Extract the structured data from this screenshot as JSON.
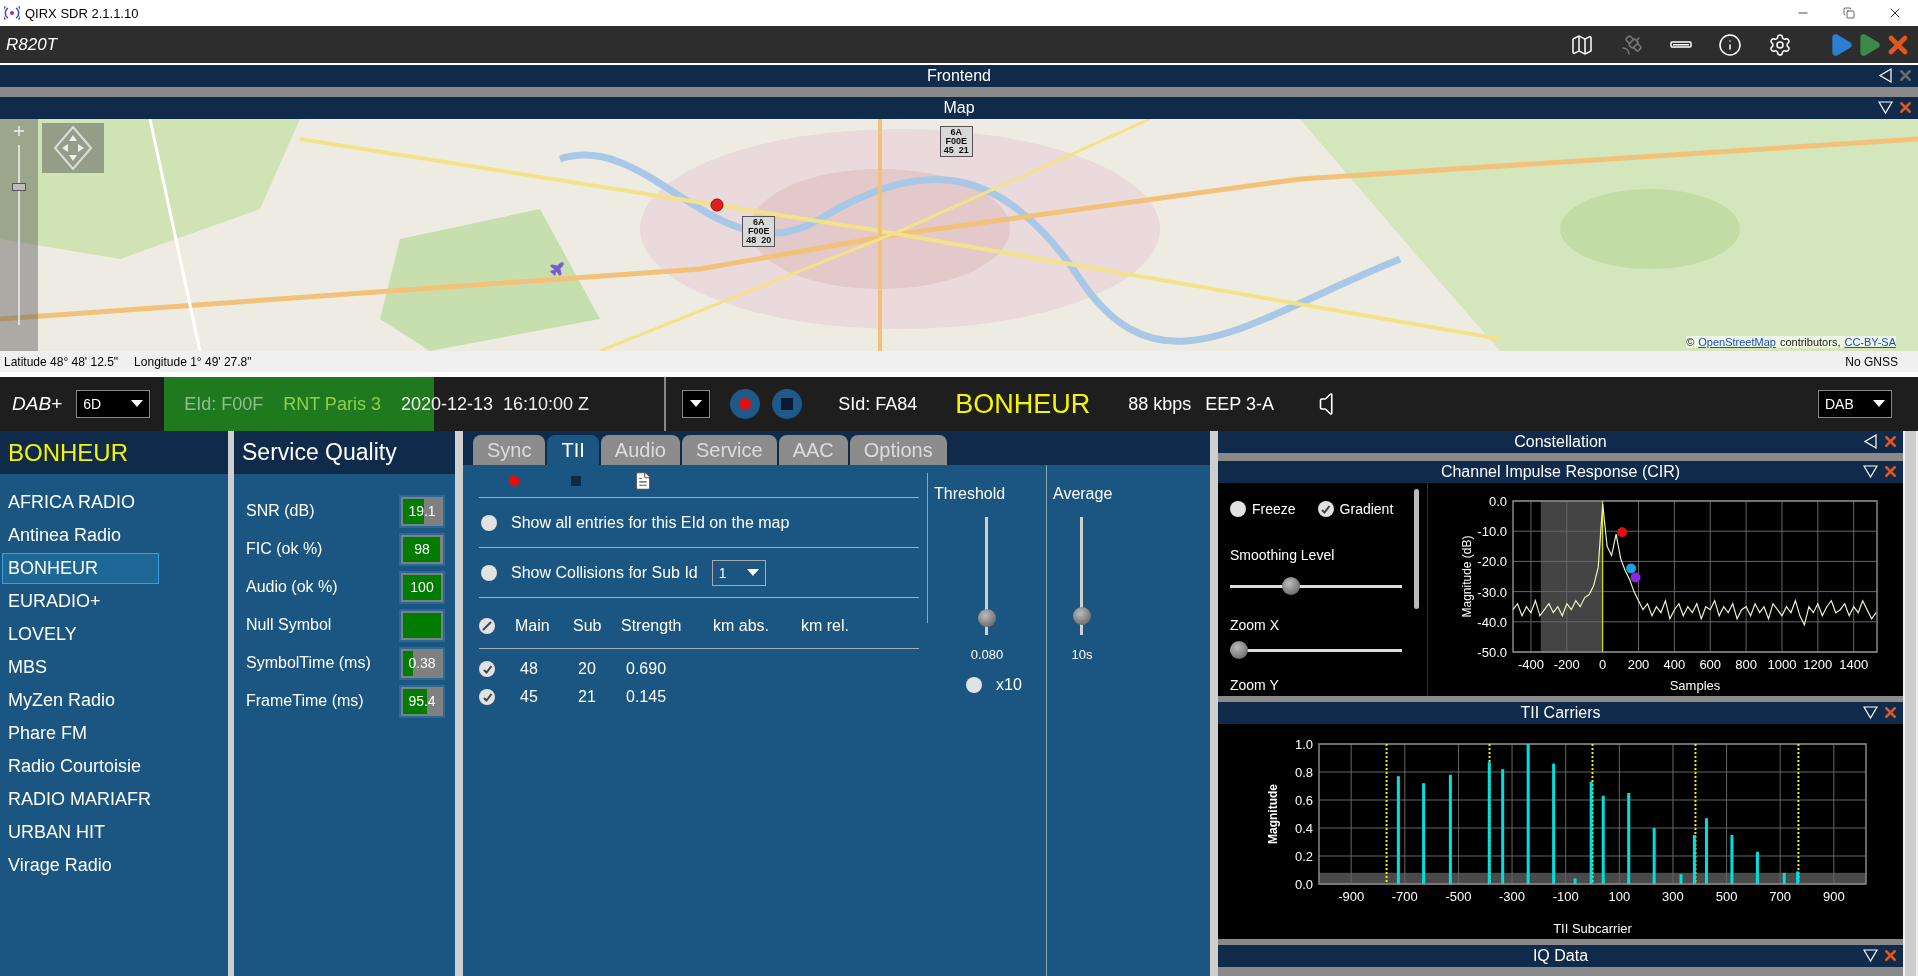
{
  "app": {
    "title": "QIRX SDR 2.1.1.10"
  },
  "toolbar": {
    "device": "R820T"
  },
  "top_panels": [
    {
      "title": "Frontend",
      "collapsed": true,
      "close_enabled": false
    },
    {
      "title": "Map",
      "collapsed": false,
      "close_enabled": true
    }
  ],
  "map": {
    "zoom": {
      "level": 0.78
    },
    "pins": [
      {
        "lines": [
          "6A",
          "F00E",
          "45  21"
        ]
      },
      {
        "lines": [
          "6A",
          "F00E",
          "48  20"
        ]
      }
    ],
    "attribution": {
      "prefix": "©",
      "link": "OpenStreetMap",
      "middle": "contributors,",
      "license": "CC-BY-SA"
    }
  },
  "map_status": {
    "latitude": "Latitude  48° 48' 12.5\"",
    "longitude": "Longitude  1° 49' 27.8\"",
    "gnss": "No GNSS"
  },
  "dab_bar": {
    "mode": "DAB+",
    "channel": "6D",
    "eid": "EId: F00F",
    "ensemble": "RNT Paris 3",
    "datetime": "2020-12-13  16:10:00 Z",
    "level": 0.54,
    "sid": "SId: FA84",
    "service": "BONHEUR",
    "bitrate": "88 kbps",
    "protection": "EEP 3-A",
    "band": "DAB"
  },
  "station_list": {
    "current": "BONHEUR",
    "items": [
      {
        "label": "AFRICA RADIO",
        "selected": false
      },
      {
        "label": "Antinea Radio",
        "selected": false
      },
      {
        "label": "BONHEUR",
        "selected": true
      },
      {
        "label": "EURADIO+",
        "selected": false
      },
      {
        "label": "LOVELY",
        "selected": false
      },
      {
        "label": "MBS",
        "selected": false
      },
      {
        "label": "MyZen Radio",
        "selected": false
      },
      {
        "label": "Phare FM",
        "selected": false
      },
      {
        "label": "Radio Courtoisie",
        "selected": false
      },
      {
        "label": "RADIO MARIAFR",
        "selected": false
      },
      {
        "label": "URBAN HIT",
        "selected": false
      },
      {
        "label": "Virage Radio",
        "selected": false
      }
    ]
  },
  "service_quality": {
    "title": "Service Quality",
    "metrics": [
      {
        "label": "SNR (dB)",
        "value": "19.1",
        "level": 0.56
      },
      {
        "label": "FIC (ok %)",
        "value": "98",
        "level": 0.98
      },
      {
        "label": "Audio (ok %)",
        "value": "100",
        "level": 1
      },
      {
        "label": "Null Symbol",
        "level": 1
      },
      {
        "label": "SymbolTime (ms)",
        "value": "0.38",
        "level": 0.25
      },
      {
        "label": "FrameTime (ms)",
        "value": "95.4",
        "level": 0.64
      }
    ]
  },
  "tabs": [
    {
      "label": "Sync",
      "selected": false
    },
    {
      "label": "TII",
      "selected": true
    },
    {
      "label": "Audio",
      "selected": false
    },
    {
      "label": "Service",
      "selected": false
    },
    {
      "label": "AAC",
      "selected": false
    },
    {
      "label": "Options",
      "selected": false
    }
  ],
  "tii": {
    "show_all": {
      "label": "Show all entries for this EId on the map",
      "checked": false
    },
    "collisions": {
      "label": "Show Collisions for Sub Id",
      "checked": false,
      "sub_id": "1"
    },
    "columns": [
      "Main",
      "Sub",
      "Strength",
      "km abs.",
      "km rel."
    ],
    "rows": [
      {
        "checked": true,
        "cells": [
          "48",
          "20",
          "0.690"
        ]
      },
      {
        "checked": true,
        "cells": [
          "45",
          "21",
          "0.145"
        ]
      }
    ],
    "threshold": {
      "label": "Threshold",
      "level": 0.08,
      "reading": "0.080",
      "x10": {
        "label": "x10",
        "checked": false
      }
    },
    "average": {
      "label": "Average",
      "level": 0.1,
      "reading": "10s"
    }
  },
  "constellation": {
    "title": "Constellation",
    "collapsed": true
  },
  "cir": {
    "title": "Channel Impulse Response (CIR)",
    "collapsed": false,
    "freeze": {
      "label": "Freeze",
      "checked": false
    },
    "gradient": {
      "label": "Gradient",
      "checked": true
    },
    "smoothing": {
      "label": "Smoothing Level",
      "level": 0.34
    },
    "zoom_x": {
      "label": "Zoom X",
      "level": 0
    },
    "zoom_y": {
      "label": "Zoom Y"
    },
    "peak_markers": [
      {
        "color": "#e01010"
      },
      {
        "color": "#20a0e0"
      },
      {
        "color": "#8a2be2"
      }
    ],
    "chart_data": {
      "type": "line",
      "xlabel": "Samples",
      "ylabel": "Magnitude (dB)",
      "grid": true,
      "x": [
        -500,
        -475,
        -450,
        -425,
        -400,
        -375,
        -350,
        -325,
        -300,
        -275,
        -250,
        -225,
        -200,
        -175,
        -150,
        -125,
        -100,
        -75,
        -50,
        -25,
        0,
        25,
        50,
        75,
        100,
        125,
        150,
        175,
        200,
        225,
        250,
        275,
        300,
        325,
        350,
        375,
        400,
        425,
        450,
        475,
        500,
        525,
        550,
        575,
        600,
        625,
        650,
        675,
        700,
        725,
        750,
        775,
        800,
        825,
        850,
        875,
        900,
        925,
        950,
        975,
        1000,
        1025,
        1050,
        1075,
        1100,
        1125,
        1150,
        1175,
        1200,
        1225,
        1250,
        1275,
        1300,
        1325,
        1350,
        1375,
        1400,
        1425,
        1450,
        1475,
        1500,
        1525
      ],
      "series": [
        {
          "color": "#e6f5c0",
          "values": [
            -36,
            -34,
            -38,
            -35,
            -37,
            -33,
            -38,
            -36,
            -34,
            -37,
            -35,
            -38,
            -34,
            -36,
            -33,
            -35,
            -32,
            -31,
            -28,
            -22,
            -1,
            -15,
            -18,
            -11,
            -19,
            -23,
            -26,
            -30,
            -33,
            -36,
            -34,
            -38,
            -35,
            -37,
            -33,
            -39,
            -36,
            -34,
            -38,
            -35,
            -37,
            -34,
            -39,
            -35,
            -36,
            -33,
            -38,
            -35,
            -37,
            -34,
            -39,
            -36,
            -35,
            -38,
            -34,
            -37,
            -35,
            -39,
            -34,
            -36,
            -38,
            -35,
            -37,
            -33,
            -38,
            -41,
            -35,
            -37,
            -34,
            -38,
            -35,
            -33,
            -37,
            -36,
            -34,
            -38,
            -35,
            -37,
            -33,
            -36,
            -39,
            -37
          ]
        }
      ],
      "xlim": [
        -500,
        1530
      ],
      "ylim": [
        -50,
        0
      ],
      "xticks": [
        -400,
        -200,
        0,
        200,
        400,
        600,
        800,
        1000,
        1200,
        1400
      ],
      "yticks": [
        {
          "value": 0,
          "label": "0.0"
        },
        {
          "value": -10,
          "label": "-10.0"
        },
        {
          "value": -20,
          "label": "-20.0"
        },
        {
          "value": -30,
          "label": "-30.0"
        },
        {
          "value": -40,
          "label": "-40.0"
        },
        {
          "value": -50,
          "label": "-50.0"
        }
      ],
      "bands": [
        {
          "axis": "x",
          "from": -345,
          "to": 0
        }
      ],
      "ref_lines": [
        {
          "axis": "x",
          "value": 0
        }
      ]
    }
  },
  "tii_carriers": {
    "title": "TII Carriers",
    "collapsed": false,
    "chart_data": {
      "type": "bar",
      "xlabel": "TII Subcarrier",
      "ylabel": "Magnitude",
      "grid": true,
      "x": [
        -724,
        -630,
        -530,
        -385,
        -335,
        -240,
        -145,
        -65,
        -5,
        40,
        135,
        230,
        330,
        380,
        425,
        520,
        615,
        715,
        765
      ],
      "series": [
        {
          "color": "#00e0e0",
          "values": [
            0.77,
            0.72,
            0.78,
            0.87,
            0.82,
            1.0,
            0.86,
            0.04,
            0.73,
            0.63,
            0.65,
            0.4,
            0.07,
            0.35,
            0.47,
            0.35,
            0.23,
            0.08,
            0.09
          ]
        }
      ],
      "xlim": [
        -1020,
        1020
      ],
      "ylim": [
        0,
        1
      ],
      "xticks": [
        -900,
        -700,
        -500,
        -300,
        -100,
        100,
        300,
        500,
        700,
        900
      ],
      "yticks": [
        {
          "value": 0,
          "label": "0.0"
        },
        {
          "value": 0.2,
          "label": "0.2"
        },
        {
          "value": 0.4,
          "label": "0.4"
        },
        {
          "value": 0.6,
          "label": "0.6"
        },
        {
          "value": 0.8,
          "label": "0.8"
        },
        {
          "value": 1,
          "label": "1.0"
        }
      ],
      "bands": [
        {
          "axis": "y",
          "from": 0,
          "to": 0.08
        }
      ],
      "ref_lines": [
        {
          "axis": "x",
          "value": -768
        },
        {
          "axis": "x",
          "value": -384
        },
        {
          "axis": "x",
          "value": 0
        },
        {
          "axis": "x",
          "value": 384
        },
        {
          "axis": "x",
          "value": 768
        }
      ]
    }
  },
  "iq_data": {
    "title": "IQ Data",
    "collapsed": false
  }
}
